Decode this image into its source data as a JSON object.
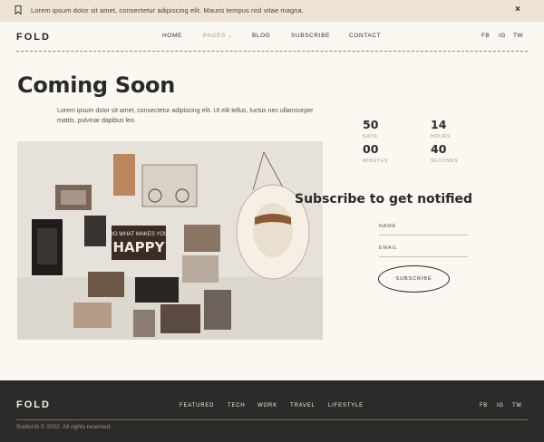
{
  "announcement": {
    "text": "Lorem ipsum dolor sit amet, consectetur adipiscing elit. Mauris tempus nisl vitae magna.",
    "close": "×"
  },
  "header": {
    "logo": "FOLD",
    "nav": {
      "home": "HOME",
      "pages": "PAGES",
      "blog": "BLOG",
      "subscribe": "SUBSCRIBE",
      "contact": "CONTACT"
    },
    "social": {
      "fb": "FB",
      "ig": "IG",
      "tw": "TW"
    }
  },
  "hero": {
    "title": "Coming Soon",
    "description": "Lorem ipsum dolor sit amet, consectetur adipiscing elit. Ut elit tellus, luctus nec ullamcorper mattis, pulvinar dapibus leo."
  },
  "photo": {
    "poster_line1": "DO WHAT MAKES YOU",
    "poster_line2": "HAPPY"
  },
  "countdown": {
    "days": {
      "value": "50",
      "label": "DAYS"
    },
    "hours": {
      "value": "14",
      "label": "HOURS"
    },
    "minutes": {
      "value": "00",
      "label": "MINUTES"
    },
    "seconds": {
      "value": "40",
      "label": "SECONDS"
    }
  },
  "subscribe": {
    "title": "Subscribe to get notified",
    "name_label": "NAME",
    "email_label": "EMAIL",
    "button": "SUBSCRIBE"
  },
  "footer": {
    "logo": "FOLD",
    "nav": {
      "featured": "FEATURED",
      "tech": "TECH",
      "work": "WORK",
      "travel": "TRAVEL",
      "lifestyle": "LIFESTYLE"
    },
    "social": {
      "fb": "FB",
      "ig": "IG",
      "tw": "TW"
    },
    "copyright": "Sodiol.lb © 2022. All rights reserved."
  },
  "colors": {
    "background": "#fbf8f1",
    "announcement_bg": "#ede4d3",
    "footer_bg": "#2c2b29",
    "text": "#2b2b2b",
    "muted": "#9a9488"
  }
}
